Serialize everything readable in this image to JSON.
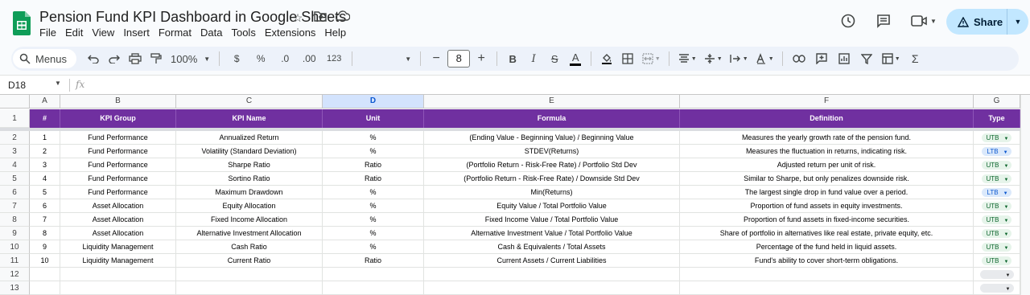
{
  "app": {
    "title": "Pension Fund KPI Dashboard in Google Sheets",
    "menu": [
      "File",
      "Edit",
      "View",
      "Insert",
      "Format",
      "Data",
      "Tools",
      "Extensions",
      "Help"
    ],
    "share_label": "Share",
    "accent_color": "#c2e7ff",
    "logo_color": "#0f9d58"
  },
  "toolbar": {
    "menus_label": "Menus",
    "zoom": "100%",
    "currency": "$",
    "percent": "%",
    "dec_decrease": ".0",
    "dec_increase": ".00",
    "number_format": "123",
    "font_size": "8",
    "icons": [
      "search-icon",
      "undo-icon",
      "redo-icon",
      "print-icon",
      "paint-format-icon",
      "bold-icon",
      "italic-icon",
      "strikethrough-icon",
      "text-color-icon",
      "fill-color-icon",
      "borders-icon",
      "merge-icon",
      "align-icon",
      "valign-icon",
      "wrap-icon",
      "rotate-icon",
      "link-icon",
      "comment-icon",
      "chart-icon",
      "filter-icon",
      "filter-views-icon",
      "functions-icon"
    ]
  },
  "formula_bar": {
    "cell_ref": "D18",
    "fx": "fx",
    "value": ""
  },
  "columns": [
    "A",
    "B",
    "C",
    "D",
    "E",
    "F",
    "G"
  ],
  "selected_column": "D",
  "header_row": [
    "#",
    "KPI Group",
    "KPI Name",
    "Unit",
    "Formula",
    "Definition",
    "Type"
  ],
  "header_color": "#7030a0",
  "rows": [
    [
      "1",
      "Fund Performance",
      "Annualized Return",
      "%",
      "(Ending Value - Beginning Value) / Beginning Value",
      "Measures the yearly growth rate of the pension fund.",
      "UTB"
    ],
    [
      "2",
      "Fund Performance",
      "Volatility (Standard Deviation)",
      "%",
      "STDEV(Returns)",
      "Measures the fluctuation in returns, indicating risk.",
      "LTB"
    ],
    [
      "3",
      "Fund Performance",
      "Sharpe Ratio",
      "Ratio",
      "(Portfolio Return - Risk-Free Rate) / Portfolio Std Dev",
      "Adjusted return per unit of risk.",
      "UTB"
    ],
    [
      "4",
      "Fund Performance",
      "Sortino Ratio",
      "Ratio",
      "(Portfolio Return - Risk-Free Rate) / Downside Std Dev",
      "Similar to Sharpe, but only penalizes downside risk.",
      "UTB"
    ],
    [
      "5",
      "Fund Performance",
      "Maximum Drawdown",
      "%",
      "Min(Returns)",
      "The largest single drop in fund value over a period.",
      "LTB"
    ],
    [
      "6",
      "Asset Allocation",
      "Equity Allocation",
      "%",
      "Equity Value / Total Portfolio Value",
      "Proportion of fund assets in equity investments.",
      "UTB"
    ],
    [
      "7",
      "Asset Allocation",
      "Fixed Income Allocation",
      "%",
      "Fixed Income Value / Total Portfolio Value",
      "Proportion of fund assets in fixed-income securities.",
      "UTB"
    ],
    [
      "8",
      "Asset Allocation",
      "Alternative Investment Allocation",
      "%",
      "Alternative Investment Value / Total Portfolio Value",
      "Share of portfolio in alternatives like real estate, private equity, etc.",
      "UTB"
    ],
    [
      "9",
      "Liquidity Management",
      "Cash Ratio",
      "%",
      "Cash & Equivalents / Total Assets",
      "Percentage of the fund held in liquid assets.",
      "UTB"
    ],
    [
      "10",
      "Liquidity Management",
      "Current Ratio",
      "Ratio",
      "Current Assets / Current Liabilities",
      "Fund's ability to cover short-term obligations.",
      "UTB"
    ],
    [
      "",
      "",
      "",
      "",
      "",
      "",
      ""
    ],
    [
      "",
      "",
      "",
      "",
      "",
      "",
      ""
    ]
  ],
  "row_numbers": [
    "1",
    "2",
    "3",
    "4",
    "5",
    "6",
    "7",
    "8",
    "9",
    "10",
    "11",
    "12",
    "13"
  ]
}
